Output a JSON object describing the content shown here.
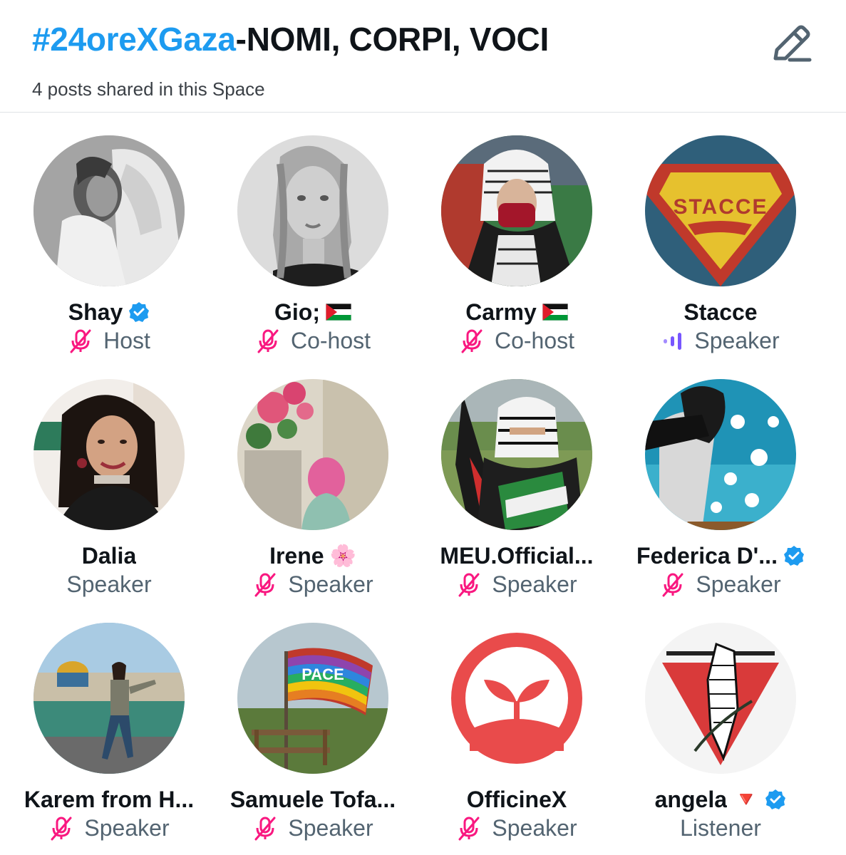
{
  "header": {
    "hashtag": "#24oreXGaza",
    "title_rest": "-NOMI, CORPI, VOCI",
    "posts_shared": "4 posts shared in this Space",
    "edit_icon": "edit-pencil-icon"
  },
  "participants": [
    {
      "name": "Shay",
      "verified": true,
      "flag": false,
      "emoji": "",
      "role": "Host",
      "mic": "muted"
    },
    {
      "name": "Gio;",
      "verified": false,
      "flag": true,
      "emoji": "",
      "role": "Co-host",
      "mic": "muted"
    },
    {
      "name": "Carmy",
      "verified": false,
      "flag": true,
      "emoji": "",
      "role": "Co-host",
      "mic": "muted"
    },
    {
      "name": "Stacce",
      "verified": false,
      "flag": false,
      "emoji": "",
      "role": "Speaker",
      "mic": "speaking"
    },
    {
      "name": "Dalia",
      "verified": false,
      "flag": false,
      "emoji": "",
      "role": "Speaker",
      "mic": "none"
    },
    {
      "name": "Irene",
      "verified": false,
      "flag": false,
      "emoji": "🌸",
      "role": "Speaker",
      "mic": "muted"
    },
    {
      "name": "MEU.Official...",
      "verified": false,
      "flag": false,
      "emoji": "",
      "role": "Speaker",
      "mic": "muted"
    },
    {
      "name": "Federica D'...",
      "verified": true,
      "flag": false,
      "emoji": "",
      "role": "Speaker",
      "mic": "muted"
    },
    {
      "name": "Karem from H...",
      "verified": false,
      "flag": false,
      "emoji": "",
      "role": "Speaker",
      "mic": "muted"
    },
    {
      "name": "Samuele Tofa...",
      "verified": false,
      "flag": false,
      "emoji": "",
      "role": "Speaker",
      "mic": "muted"
    },
    {
      "name": "OfficineX",
      "verified": false,
      "flag": false,
      "emoji": "",
      "role": "Speaker",
      "mic": "muted"
    },
    {
      "name": "angela",
      "verified": true,
      "flag": false,
      "emoji": "🔻",
      "role": "Listener",
      "mic": "none"
    }
  ],
  "avatar_texts": {
    "stacce_logo": "STACCE",
    "pace_flag": "PACE"
  },
  "colors": {
    "accent": "#1d9bf0",
    "muted_mic": "#f91880",
    "speaking_bars": "#7856ff",
    "role_text": "#536471"
  }
}
